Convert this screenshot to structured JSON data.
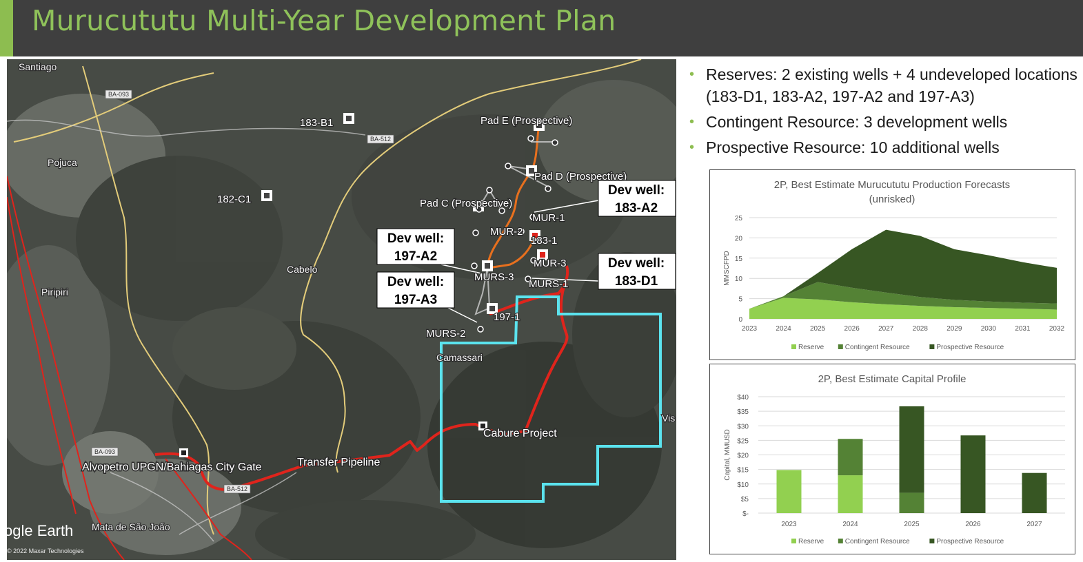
{
  "header": {
    "title": "Murucututu Multi-Year Development Plan"
  },
  "bullets": [
    "Reserves:  2 existing wells + 4 undeveloped locations (183-D1, 183-A2, 197-A2 and 197-A3)",
    "Contingent Resource:  3 development wells",
    "Prospective Resource:  10 additional wells"
  ],
  "map": {
    "places": [
      "Santiago",
      "Pojuca",
      "Piripiri",
      "Cabelo",
      "Camassari",
      "Mata de São João",
      "Vis"
    ],
    "roads": [
      "BA-093",
      "BA-512",
      "BA-093",
      "BA-512"
    ],
    "wells": [
      "183-B1",
      "182-C1",
      "Pad E (Prospective)",
      "Pad D (Prospective)",
      "Pad C (Prospective)",
      "MUR-1",
      "MUR-2",
      "183-1",
      "MUR-3",
      "MURS-3",
      "MURS-1",
      "197-1",
      "MURS-2"
    ],
    "facilities": [
      "Cabure Project",
      "Alvopetro UPGN/Bahiagas City Gate",
      "Transfer Pipeline"
    ],
    "callouts": [
      {
        "line1": "Dev well:",
        "line2": "183-A2"
      },
      {
        "line1": "Dev well:",
        "line2": "197-A2"
      },
      {
        "line1": "Dev well:",
        "line2": "183-D1"
      },
      {
        "line1": "Dev well:",
        "line2": "197-A3"
      }
    ],
    "watermark": "ogle Earth",
    "copyright": "© 2022 Maxar Technologies",
    "colors": {
      "pipeline": "#e0241c",
      "project_boundary": "#5be3ee",
      "gathering": "#e8701e",
      "road": "#e3cc7a"
    }
  },
  "chart_data": [
    {
      "type": "area",
      "title": "2P, Best Estimate Murucututu Production Forecasts",
      "subtitle": "(unrisked)",
      "xlabel": "",
      "ylabel": "MMSCFPD",
      "ylim": [
        0,
        25
      ],
      "yticks": [
        "0",
        "5",
        "10",
        "15",
        "20",
        "25"
      ],
      "x": [
        "2023",
        "2024",
        "2025",
        "2026",
        "2027",
        "2028",
        "2029",
        "2030",
        "2031",
        "2032"
      ],
      "stacked": true,
      "series": [
        {
          "name": "Reserve",
          "color": "#92d050",
          "values": [
            2.5,
            5.2,
            4.8,
            4.1,
            3.6,
            3.2,
            2.9,
            2.7,
            2.5,
            2.3
          ]
        },
        {
          "name": "Contingent Resource",
          "color": "#548235",
          "values": [
            0,
            0.4,
            4.3,
            3.6,
            2.9,
            2.2,
            1.8,
            1.6,
            1.5,
            1.5
          ]
        },
        {
          "name": "Prospective Resource",
          "color": "#375623",
          "values": [
            0,
            0,
            2.2,
            9.5,
            15.5,
            15.1,
            12.5,
            11.4,
            10.0,
            8.8
          ]
        }
      ],
      "grid": true,
      "legend": "bottom"
    },
    {
      "type": "bar",
      "title": "2P, Best Estimate Capital Profile",
      "xlabel": "",
      "ylabel": "Capital, MMUSD",
      "ylim": [
        0,
        40
      ],
      "yticks": [
        "$-",
        "$5",
        "$10",
        "$15",
        "$20",
        "$25",
        "$30",
        "$35",
        "$40"
      ],
      "categories": [
        "2023",
        "2024",
        "2025",
        "2026",
        "2027"
      ],
      "stacked": true,
      "series": [
        {
          "name": "Reserve",
          "color": "#92d050",
          "values": [
            14.8,
            13.0,
            0,
            0,
            0
          ]
        },
        {
          "name": "Contingent Resource",
          "color": "#548235",
          "values": [
            0,
            12.5,
            7.0,
            0,
            0
          ]
        },
        {
          "name": "Prospective Resource",
          "color": "#375623",
          "values": [
            0,
            0,
            29.7,
            26.7,
            13.8
          ]
        }
      ],
      "grid": true,
      "legend": "bottom"
    }
  ]
}
